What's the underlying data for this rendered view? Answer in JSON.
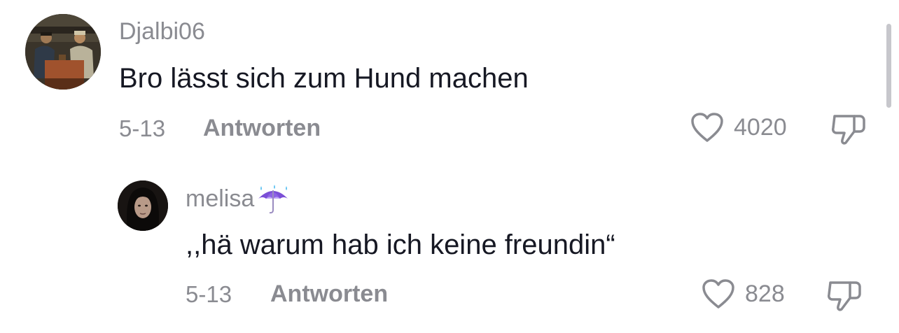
{
  "comments": [
    {
      "username": "Djalbi06",
      "text": "Bro lässt sich zum Hund machen",
      "date": "5-13",
      "reply_label": "Antworten",
      "likes": "4020",
      "avatar": "card-players-painting-avatar"
    },
    {
      "username": "melisa",
      "username_emoji": "umbrella-with-rain-icon",
      "text": ",,hä warum hab ich keine freundin“",
      "date": "5-13",
      "reply_label": "Antworten",
      "likes": "828",
      "avatar": "dark-hair-portrait-avatar"
    }
  ],
  "colors": {
    "text": "#161823",
    "secondary": "#8a8b91",
    "scrollbar": "#c7c7cc"
  }
}
